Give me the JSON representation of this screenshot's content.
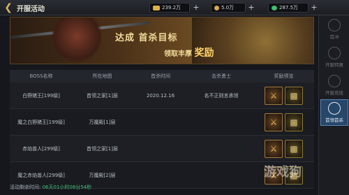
{
  "header": {
    "title": "开服活动",
    "currencies": [
      {
        "value": "239.2万",
        "icon": "gold-ingot-icon",
        "color": "#e0b04a"
      },
      {
        "value": "5.0万",
        "icon": "gold-coin-icon",
        "color": "#d8a84a"
      },
      {
        "value": "287.5万",
        "icon": "green-gem-icon",
        "color": "#3fbf6a"
      }
    ]
  },
  "banner": {
    "line1": "达成 首杀目标",
    "line2a": "领取丰厚",
    "line2b": "奖励"
  },
  "table": {
    "headers": [
      "BOSS名称",
      "所在地图",
      "首杀时间",
      "击杀勇士",
      "奖励预览"
    ],
    "rows": [
      {
        "name": "白野猪王[199级]",
        "map": "首领之家[1]层",
        "time": "2020.12.16",
        "killer": "名不正则言承旭"
      },
      {
        "name": "魔之白野猪王[199级]",
        "map": "万魔殿[1]层",
        "time": "",
        "killer": ""
      },
      {
        "name": "赤焰兽人[299级]",
        "map": "首领之家[1]层",
        "time": "",
        "killer": ""
      },
      {
        "name": "魔之赤焰兽人[299级]",
        "map": "万魔殿[2]层",
        "time": "",
        "killer": ""
      }
    ]
  },
  "sidebar": {
    "items": [
      {
        "label": "首冲",
        "active": false
      },
      {
        "label": "开服特惠",
        "active": false
      },
      {
        "label": "开服竞技",
        "active": false
      },
      {
        "label": "首领首杀",
        "active": true
      }
    ]
  },
  "footer": {
    "label": "活动剩余时间:",
    "time": "06天01小时08分54秒"
  },
  "watermark": "游戏狗"
}
